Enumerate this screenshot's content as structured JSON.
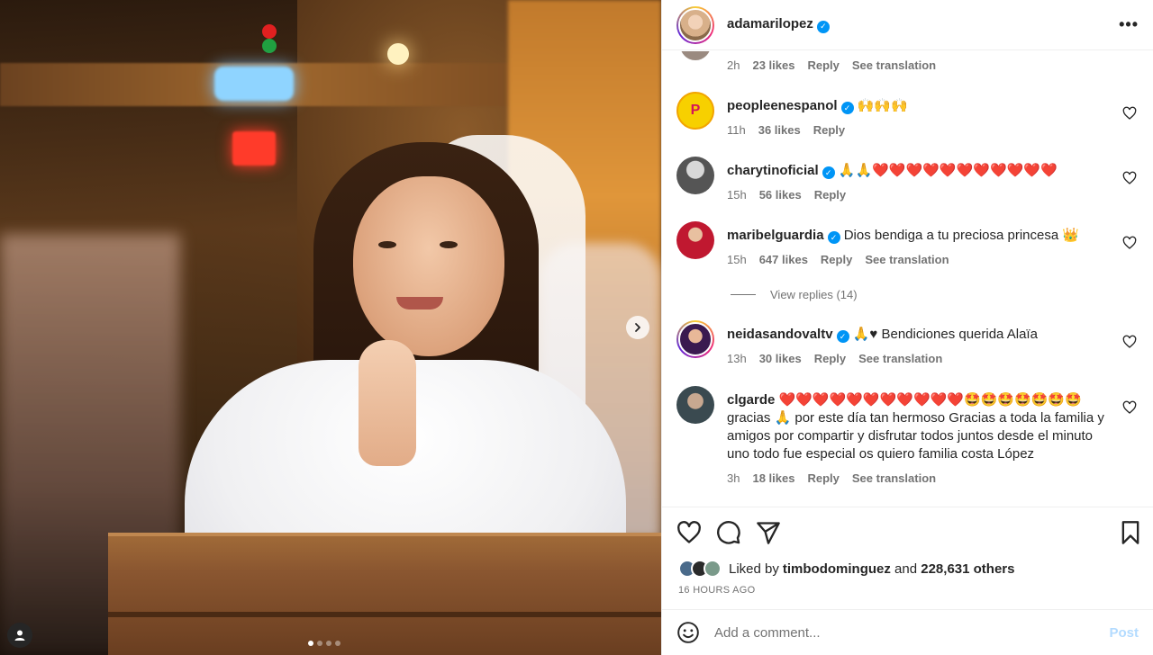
{
  "post": {
    "author": "adamarilopez",
    "more_icon": "•••",
    "partial_meta": {
      "time": "2h",
      "likes": "23 likes",
      "reply": "Reply",
      "translate": "See translation"
    }
  },
  "comments": [
    {
      "user": "peopleenespanol",
      "verified": true,
      "text": "🙌🙌🙌",
      "time": "11h",
      "likes": "36 likes",
      "reply": "Reply",
      "translate": ""
    },
    {
      "user": "charytinoficial",
      "verified": true,
      "text": "🙏🙏❤️❤️❤️❤️❤️❤️❤️❤️❤️❤️❤️",
      "time": "15h",
      "likes": "56 likes",
      "reply": "Reply",
      "translate": ""
    },
    {
      "user": "maribelguardia",
      "verified": true,
      "text": "Dios bendiga a tu preciosa princesa 👑",
      "time": "15h",
      "likes": "647 likes",
      "reply": "Reply",
      "translate": "See translation"
    },
    {
      "user": "neidasandovaltv",
      "verified": true,
      "text": "🙏♥ Bendiciones querida Alaïa",
      "time": "13h",
      "likes": "30 likes",
      "reply": "Reply",
      "translate": "See translation"
    },
    {
      "user": "clgarde",
      "verified": false,
      "text": "❤️❤️❤️❤️❤️❤️❤️❤️❤️❤️❤️🤩🤩🤩🤩🤩🤩🤩 gracias 🙏 por este día tan hermoso Gracias a toda la familia y amigos por compartir y disfrutar todos juntos desde el minuto uno todo fue especial os quiero familia costa López",
      "time": "3h",
      "likes": "18 likes",
      "reply": "Reply",
      "translate": "See translation"
    }
  ],
  "view_replies": "View replies (14)",
  "likes": {
    "prefix": "Liked by ",
    "user": "timbodominguez",
    "and": " and ",
    "count": "228,631 others"
  },
  "time_ago": "16 HOURS AGO",
  "add_comment": {
    "placeholder": "Add a comment...",
    "post_label": "Post"
  },
  "icons": {
    "like": "heart-icon",
    "comment": "comment-icon",
    "share": "share-icon",
    "save": "bookmark-icon",
    "emoji": "emoji-icon",
    "next": "chevron-right-icon",
    "tag": "user-tag-icon"
  },
  "carousel": {
    "count": 4,
    "active": 0
  },
  "colors": {
    "verified": "#0095f6",
    "post_disabled": "#b3dbff",
    "heart_red": "#ed4956"
  }
}
